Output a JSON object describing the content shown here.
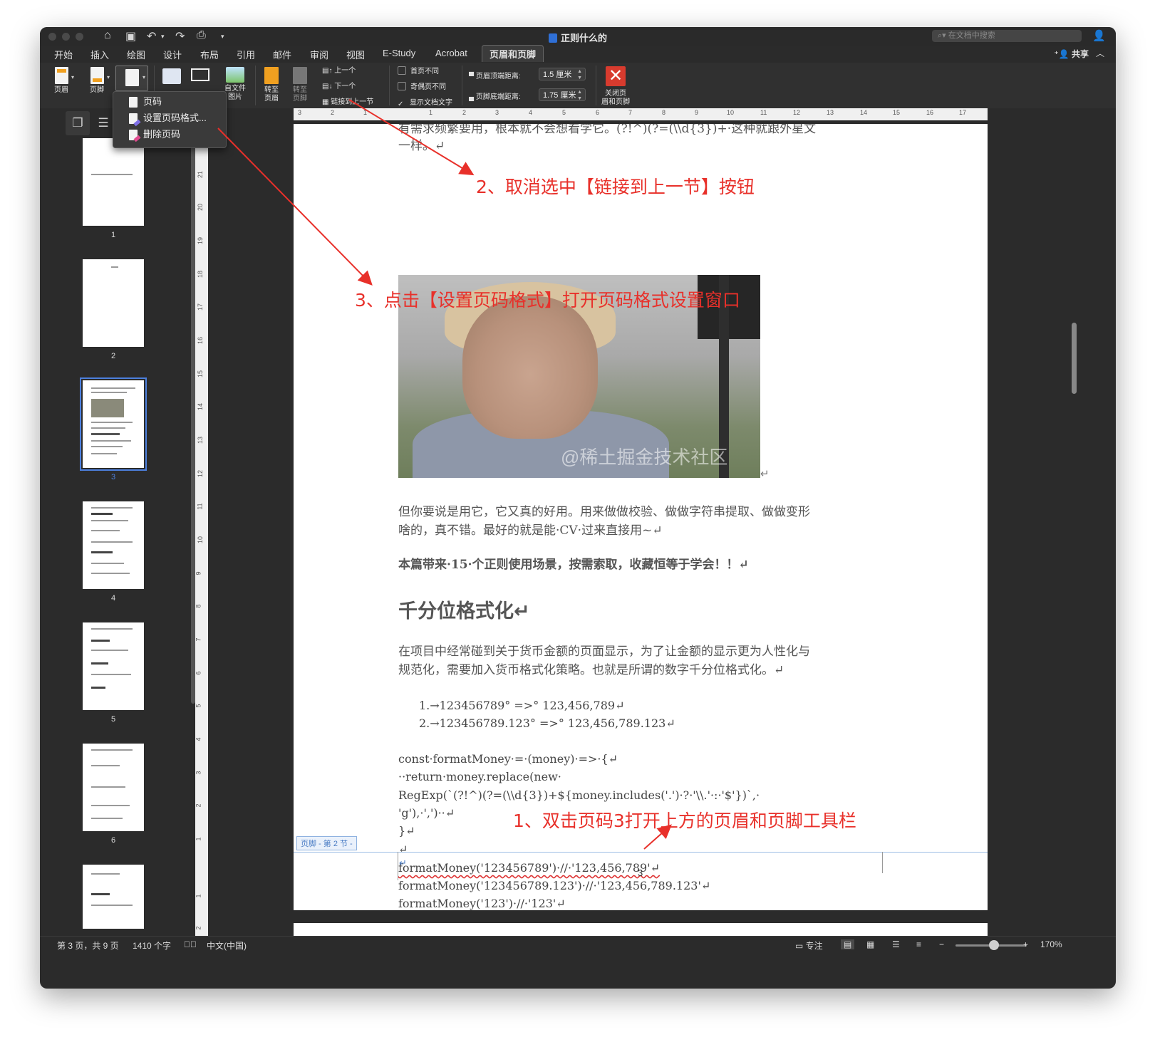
{
  "window": {
    "title": "正则什么的",
    "search_placeholder": "在文档中搜索"
  },
  "tabs": [
    "开始",
    "插入",
    "绘图",
    "设计",
    "布局",
    "引用",
    "邮件",
    "审阅",
    "视图",
    "E-Study",
    "Acrobat",
    "页眉和页脚"
  ],
  "active_tab": "页眉和页脚",
  "share_label": "共享",
  "ribbon": {
    "header": "页眉",
    "footer": "页脚",
    "from_file_line1": "自文件",
    "from_file_line2": "图片",
    "goto_header_line1": "转至",
    "goto_header_line2": "页眉",
    "goto_footer_line1": "转至",
    "goto_footer_line2": "页脚",
    "previous": "上一个",
    "next": "下一个",
    "link_to_previous": "链接到上一节",
    "different_first_page": "首页不同",
    "different_odd_even": "奇偶页不同",
    "show_document_text": "显示文档文字",
    "header_top_label": "页眉顶端距离:",
    "header_top_value": "1.5 厘米",
    "footer_bottom_label": "页脚底端距离:",
    "footer_bottom_value": "1.75 厘米",
    "close_line1": "关闭页",
    "close_line2": "眉和页脚"
  },
  "page_number_menu": {
    "items": [
      "页码",
      "设置页码格式...",
      "删除页码"
    ]
  },
  "nav": {
    "thumbnail_numbers": [
      "1",
      "2",
      "3",
      "4",
      "5",
      "6"
    ],
    "selected": "3"
  },
  "ruler": {
    "h": [
      "3",
      "2",
      "1",
      "1",
      "2",
      "3",
      "4",
      "5",
      "6",
      "7",
      "8",
      "9",
      "10",
      "11",
      "12",
      "13",
      "14",
      "15",
      "16",
      "17"
    ],
    "v": [
      "21",
      "20",
      "19",
      "18",
      "17",
      "16",
      "15",
      "14",
      "13",
      "12",
      "11",
      "10",
      "9",
      "8",
      "7",
      "6",
      "5",
      "4",
      "3",
      "2",
      "1",
      "1",
      "2"
    ]
  },
  "document": {
    "top_line1": "有需求频繁要用，根本就不会想看学它。(?!^)(?=(\\\\d{3})+·这种就跟外星文",
    "top_line2": "一样。↵",
    "watermark": "@稀土掘金技术社区",
    "para1_line1": "但你要说是用它，它又真的好用。用来做做校验、做做字符串提取、做做变形",
    "para1_line2": "啥的，真不错。最好的就是能·CV·过来直接用~↵",
    "para2": "本篇带来·15·个正则使用场景，按需索取，收藏恒等于学会！！↵",
    "heading": "千分位格式化↵",
    "para3_line1": "在项目中经常碰到关于货币金额的页面显示，为了让金额的显示更为人性化与",
    "para3_line2": "规范化，需要加入货币格式化策略。也就是所谓的数字千分位格式化。↵",
    "list": [
      "1.→123456789°  =>°  123,456,789↵",
      "2.→123456789.123°  =>°  123,456,789.123↵"
    ],
    "code": [
      "const·formatMoney·=·(money)·=>·{↵",
      "··return·money.replace(new·",
      "RegExp(`(?!^)(?=(\\\\d{3})+${money.includes('.')·?·'\\\\.'·:·'$'})`,·",
      "'g'),·',')··↵",
      "}↵",
      "↵",
      "formatMoney('123456789')·//·'123,456,789'↵",
      "formatMoney('123456789.123')·//·'123,456,789.123'↵",
      "formatMoney('123')·//·'123'↵"
    ],
    "footer_tag": "页脚 - 第 2 节 -",
    "footer_cursor": "↵",
    "footer_page_number": "3"
  },
  "annotations": {
    "step1": "1、双击页码3打开上方的页眉和页脚工具栏",
    "step2": "2、取消选中【链接到上一节】按钮",
    "step3": "3、点击【设置页码格式】打开页码格式设置窗口",
    "color": "#e8302a"
  },
  "statusbar": {
    "page": "第 3 页，共 9 页",
    "words": "1410 个字",
    "language": "中文(中国)",
    "focus": "专注",
    "zoom": "170%"
  }
}
